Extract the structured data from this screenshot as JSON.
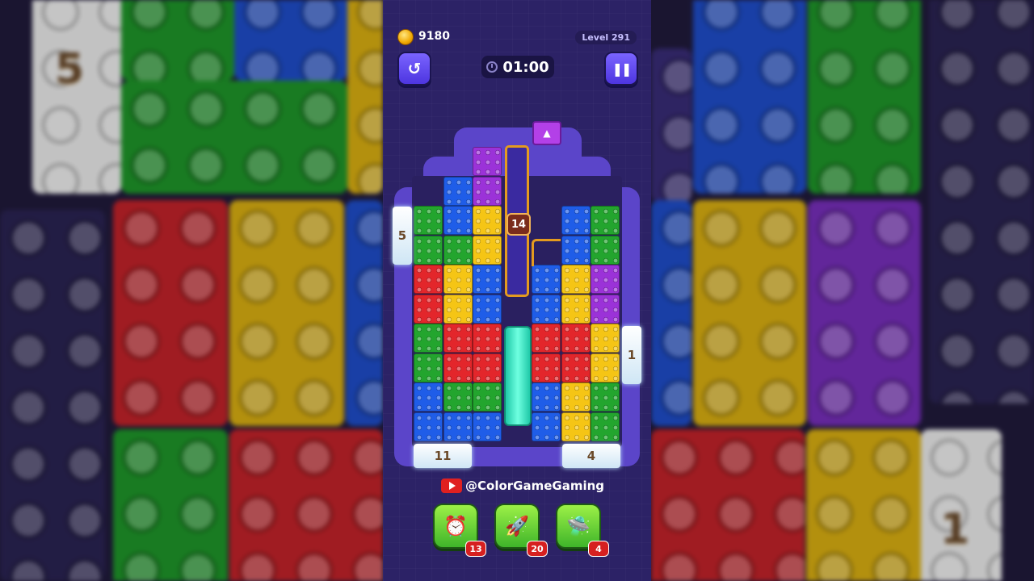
{
  "hud": {
    "coins": "9180",
    "level": "Level 291",
    "timer": "01:00",
    "undo_icon": "undo-arrow-icon",
    "pause_icon": "pause-icon"
  },
  "board": {
    "gate_count": "14",
    "ice_counts": {
      "left_top": "5",
      "right_mid": "1",
      "bottom_left": "11",
      "bottom_right": "4"
    }
  },
  "backdrop": {
    "num_left": "5",
    "num_right": "1"
  },
  "watermark": {
    "channel": "@ColorGameGaming"
  },
  "boosters": [
    {
      "icon": "alarm-clock-icon",
      "count": "13"
    },
    {
      "icon": "rocket-icon",
      "count": "20"
    },
    {
      "icon": "ufo-icon",
      "count": "4"
    }
  ],
  "colors": {
    "red": "#e3262b",
    "yellow": "#f5c515",
    "blue": "#1f5de8",
    "green": "#23a52e",
    "purple": "#9b32d8",
    "frame": "#5b45c9"
  }
}
